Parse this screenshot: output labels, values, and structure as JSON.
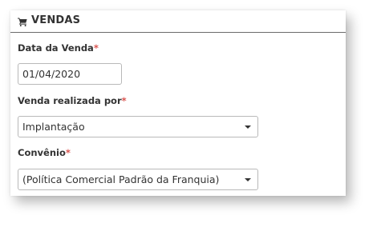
{
  "section": {
    "title": "VENDAS",
    "icon": "shopping-cart-icon"
  },
  "colors": {
    "required": "#d9534f",
    "text": "#333333",
    "border": "#b9b9b9"
  },
  "fields": {
    "data_venda": {
      "label": "Data da Venda",
      "required_mark": "*",
      "value": "01/04/2020"
    },
    "venda_realizada_por": {
      "label": "Venda realizada por",
      "required_mark": "*",
      "value": "Implantação"
    },
    "convenio": {
      "label": "Convênio",
      "required_mark": "*",
      "value": "(Política Comercial Padrão da Franquia)"
    }
  }
}
